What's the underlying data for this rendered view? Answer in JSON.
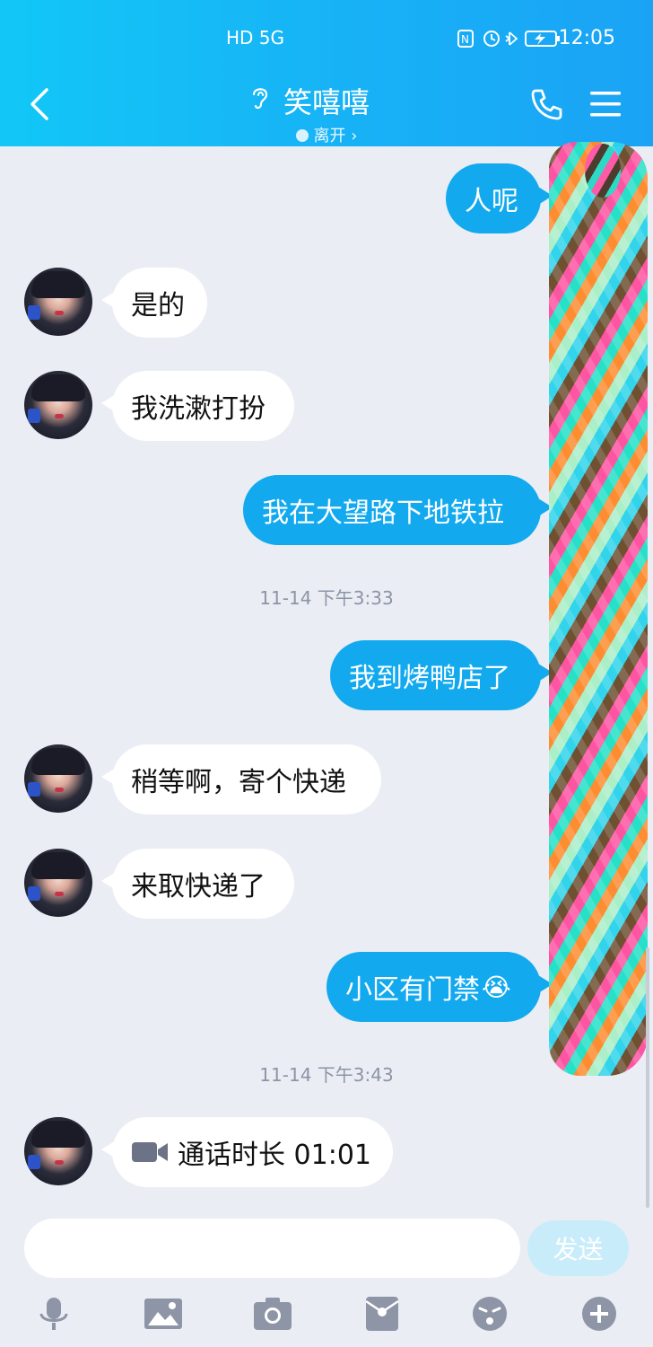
{
  "status_bar": {
    "left_icons": "HD 5G",
    "time": "12:05"
  },
  "header": {
    "contact_name": "笑嘻嘻",
    "status": "离开",
    "status_suffix": "›"
  },
  "messages": [
    {
      "side": "right",
      "text": "人呢"
    },
    {
      "side": "left",
      "text": "是的"
    },
    {
      "side": "left",
      "text": "我洗漱打扮"
    },
    {
      "side": "right",
      "text": "我在大望路下地铁拉"
    },
    {
      "side": "time",
      "text": "11-14 下午3:33"
    },
    {
      "side": "right",
      "text": "我到烤鸭店了"
    },
    {
      "side": "left",
      "text": "稍等啊，寄个快递"
    },
    {
      "side": "left",
      "text": "来取快递了"
    },
    {
      "side": "right",
      "text": "小区有门禁",
      "emoji": "😭"
    },
    {
      "side": "time",
      "text": "11-14 下午3:43"
    },
    {
      "side": "left",
      "text": "通话时长 01:01",
      "icon": "video-icon"
    }
  ],
  "input": {
    "placeholder": "",
    "send_label": "发送"
  },
  "toolbar": [
    "microphone-icon",
    "image-icon",
    "camera-icon",
    "red-packet-icon",
    "emoji-icon",
    "plus-icon"
  ],
  "colors": {
    "header": "#17b3f6",
    "bubble_right": "#12a9ee",
    "bubble_left": "#ffffff",
    "background": "#eaedf4"
  }
}
